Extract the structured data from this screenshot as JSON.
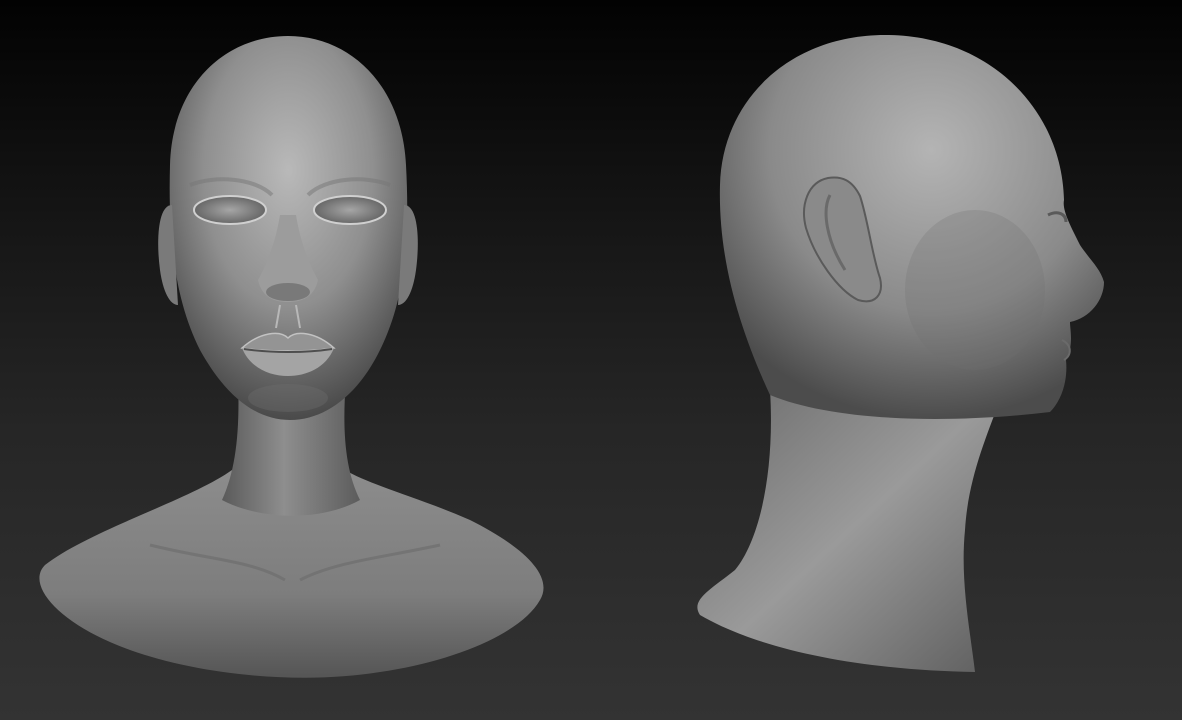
{
  "viewport": {
    "background_top": "#020202",
    "background_bottom": "#333333",
    "material_color": "#9a9a9a"
  }
}
